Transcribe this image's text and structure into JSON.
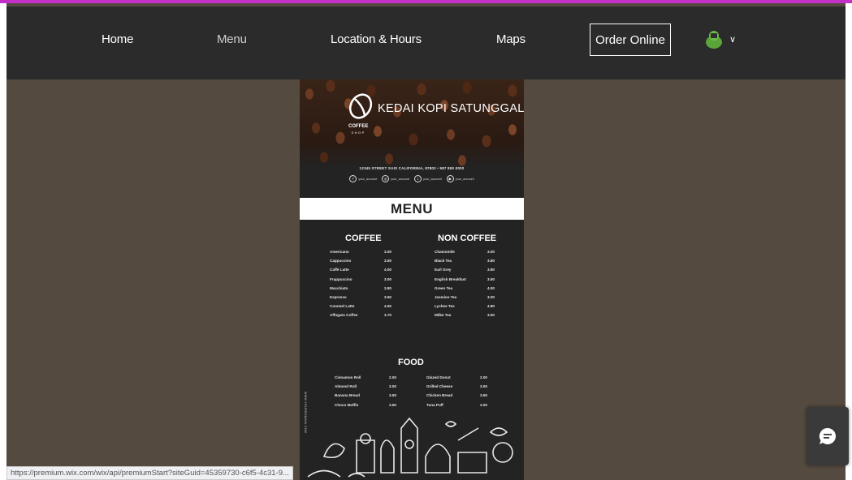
{
  "nav": {
    "items": [
      {
        "label": "Home",
        "active": false
      },
      {
        "label": "Menu",
        "active": true
      },
      {
        "label": "Location & Hours",
        "active": false
      },
      {
        "label": "Maps",
        "active": false
      }
    ],
    "order_button": "Order Online",
    "user_icon": "user-avatar-icon",
    "chevron": "∨"
  },
  "poster": {
    "brand": "KEDAI KOPI SATUNGGAL",
    "shop_tag": "COFFEE",
    "shop_sub": "SHOP",
    "address": "12345 STREET SAIS CALIFORNIA, 87802 • 987 890 0000",
    "socials": [
      "your_account",
      "your_account",
      "your_account",
      "your_account"
    ],
    "menu_title": "MENU",
    "coffee": {
      "title": "COFFEE",
      "items": [
        {
          "name": "Americano",
          "price": "3.00"
        },
        {
          "name": "Cappuccino",
          "price": "3.50"
        },
        {
          "name": "Caffè Latte",
          "price": "4.00"
        },
        {
          "name": "Frappuccino",
          "price": "3.00"
        },
        {
          "name": "Macchiato",
          "price": "3.80"
        },
        {
          "name": "Espresso",
          "price": "3.50"
        },
        {
          "name": "Caramel Latte",
          "price": "4.50"
        },
        {
          "name": "Affogato Coffee",
          "price": "3.70"
        }
      ]
    },
    "non_coffee": {
      "title": "NON COFFEE",
      "items": [
        {
          "name": "Chamomile",
          "price": "3.00"
        },
        {
          "name": "Black Tea",
          "price": "3.80"
        },
        {
          "name": "Earl Grey",
          "price": "3.80"
        },
        {
          "name": "English Breakfast",
          "price": "3.50"
        },
        {
          "name": "Green Tea",
          "price": "4.00"
        },
        {
          "name": "Jasmine Tea",
          "price": "3.00"
        },
        {
          "name": "Lychee Tea",
          "price": "4.80"
        },
        {
          "name": "Milke Tea",
          "price": "3.50"
        }
      ]
    },
    "food": {
      "title": "FOOD",
      "left": [
        {
          "name": "Cinnamon Roll",
          "price": "2.00"
        },
        {
          "name": "Almond Roll",
          "price": "3.00"
        },
        {
          "name": "Banana Bread",
          "price": "3.50"
        },
        {
          "name": "Choco Muffin",
          "price": "3.50"
        }
      ],
      "right": [
        {
          "name": "Glazed Donut",
          "price": "2.00"
        },
        {
          "name": "Grilled Cheese",
          "price": "3.00"
        },
        {
          "name": "Chicken Bread",
          "price": "3.50"
        },
        {
          "name": "Tuna Puff",
          "price": "3.00"
        }
      ]
    },
    "side_url": "WWW.YOURDOMAIN.COM"
  },
  "chat_icon": "chat-bubble-icon",
  "status_url": "https://premium.wix.com/wix/api/premiumStart?siteGuid=45359730-c6f5-4c31-9...",
  "colors": {
    "accent": "#c230c8",
    "navbar": "#2b2b2b",
    "background": "#544a3f",
    "poster": "#232323"
  }
}
